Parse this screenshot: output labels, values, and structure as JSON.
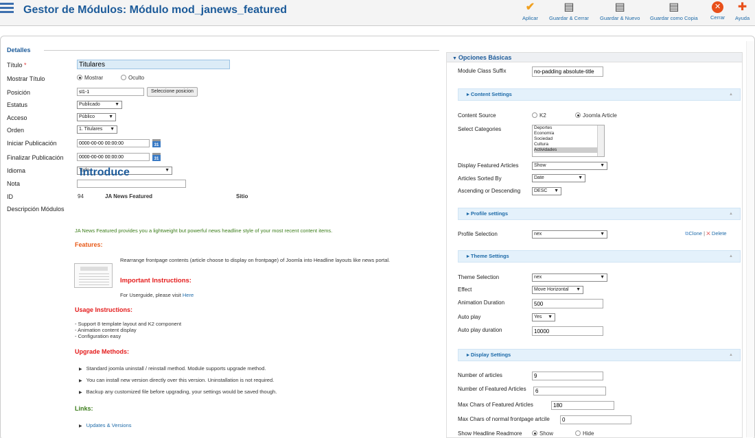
{
  "header": {
    "title": "Gestor de Módulos: Módulo mod_janews_featured",
    "toolbar": [
      {
        "label": "Aplicar",
        "icon": "check-icon"
      },
      {
        "label": "Guardar & Cerrar",
        "icon": "save-icon"
      },
      {
        "label": "Guardar & Nuevo",
        "icon": "save-new-icon"
      },
      {
        "label": "Guardar como Copia",
        "icon": "save-copy-icon"
      },
      {
        "label": "Cerrar",
        "icon": "close-icon"
      },
      {
        "label": "Ayuda",
        "icon": "help-icon"
      }
    ]
  },
  "details": {
    "legend": "Detalles",
    "titulo_label": "Título",
    "titulo_required": "*",
    "titulo_value": "Titulares",
    "mostrar_label": "Mostrar Título",
    "mostrar_opt1": "Mostrar",
    "mostrar_opt2": "Oculto",
    "posicion_label": "Posición",
    "posicion_value": "sl1-1",
    "posicion_btn": "Seleccione posicion",
    "estatus_label": "Estatus",
    "estatus_value": "Publicado",
    "acceso_label": "Acceso",
    "acceso_value": "Público",
    "orden_label": "Orden",
    "orden_value": "1. Titulares",
    "iniciar_label": "Iniciar Publicación",
    "iniciar_value": "0000-00-00 00:00:00",
    "finalizar_label": "Finalizar Publicación",
    "finalizar_value": "0000-00-00 00:00:00",
    "calendar_text": "31",
    "idioma_label": "Idioma",
    "idioma_value": "Todo",
    "nota_label": "Nota",
    "nota_value": "",
    "id_label": "ID",
    "id_value": "94",
    "module_name": "JA News Featured",
    "site_label": "Sitio",
    "descripcion_label": "Descripción Módulos"
  },
  "description": {
    "title": "Introduce",
    "intro": "JA News Featured provides you a lightweight but powerful news headline style of your most recent content items.",
    "features_h": "Features:",
    "features_text": "Rearrange frontpage contents (article choose to display on frontpage) of Joomla into Headline layouts like news portal.",
    "important_h": "Important Instructions:",
    "userguide_text": "For Userguide, please visit ",
    "userguide_link": "Here",
    "usage_h": "Usage Instructions:",
    "usage_1": "- Support 8 template layout and K2 component",
    "usage_2": "- Animation content display",
    "usage_3": "- Configuration easy",
    "upgrade_h": "Upgrade Methods:",
    "upgrade_1": "Standard joomla uninstall / reinstall method. Module supports upgrade method.",
    "upgrade_2": "You can install new version directly over this version. Uninstallation is not required.",
    "upgrade_3": "Backup any customized file before upgrading, your settings would be saved though.",
    "links_h": "Links:",
    "link_1": "Updates & Versions"
  },
  "options": {
    "header": "Opciones Básicas",
    "class_suffix_label": "Module Class Suffix",
    "class_suffix_value": "no-padding absolute-title",
    "content_settings": "Content Settings",
    "content_source_label": "Content Source",
    "content_source_opt1": "K2",
    "content_source_opt2": "Joomla Article",
    "categories_label": "Select Categories",
    "categories": [
      "Deportes",
      "Economía",
      "Sociedad",
      "Cultura",
      "Actividades"
    ],
    "display_featured_label": "Display Featured Articles",
    "display_featured_value": "Show",
    "sorted_label": "Articles Sorted By",
    "sorted_value": "Date",
    "asc_label": "Ascending or Descending",
    "asc_value": "DESC",
    "profile_settings": "Profile settings",
    "profile_label": "Profile Selection",
    "profile_value": "nex",
    "clone_label": "Clone",
    "separator": "|",
    "delete_label": "Delete",
    "theme_settings": "Theme Settings",
    "theme_label": "Theme Selection",
    "theme_value": "nex",
    "effect_label": "Effect",
    "effect_value": "Move Horizontal",
    "anim_label": "Animation Duration",
    "anim_value": "500",
    "autoplay_label": "Auto play",
    "autoplay_value": "Yes",
    "autoplay_dur_label": "Auto play duration",
    "autoplay_dur_value": "10000",
    "display_settings": "Display Settings",
    "num_articles_label": "Number of articles",
    "num_articles_value": "9",
    "num_featured_label": "Number of Featured Articles",
    "num_featured_value": "6",
    "max_featured_label": "Max Chars of Featured Articles",
    "max_featured_value": "180",
    "max_normal_label": "Max Chars of normal frontpage artcile",
    "max_normal_value": "0",
    "readmore_label": "Show Headline Readmore",
    "readmore_opt1": "Show",
    "readmore_opt2": "Hide"
  }
}
